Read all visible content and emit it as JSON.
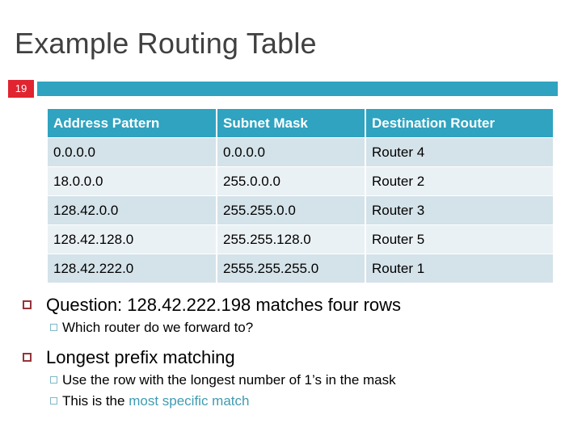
{
  "slide": {
    "title": "Example Routing Table",
    "slide_number": "19",
    "accent_color": "#2fa3c0",
    "badge_color": "#e02430",
    "title_color": "#404040",
    "highlight_color": "#3f9bb2"
  },
  "table": {
    "headers": [
      "Address Pattern",
      "Subnet Mask",
      "Destination Router"
    ],
    "rows": [
      [
        "0.0.0.0",
        "0.0.0.0",
        "Router 4"
      ],
      [
        "18.0.0.0",
        "255.0.0.0",
        "Router 2"
      ],
      [
        "128.42.0.0",
        "255.255.0.0",
        "Router 3"
      ],
      [
        "128.42.128.0",
        "255.255.128.0",
        "Router 5"
      ],
      [
        "128.42.222.0",
        "2555.255.255.0",
        "Router 1"
      ]
    ]
  },
  "bullets": {
    "question": "Question: 128.42.222.198 matches four rows",
    "question_sub": "Which router do we forward to?",
    "longest_prefix": "Longest prefix matching",
    "longest_prefix_sub1": "Use the row with the longest number of 1’s in the mask",
    "longest_prefix_sub2_prefix": "This is the ",
    "longest_prefix_sub2_highlight": "most specific match"
  }
}
